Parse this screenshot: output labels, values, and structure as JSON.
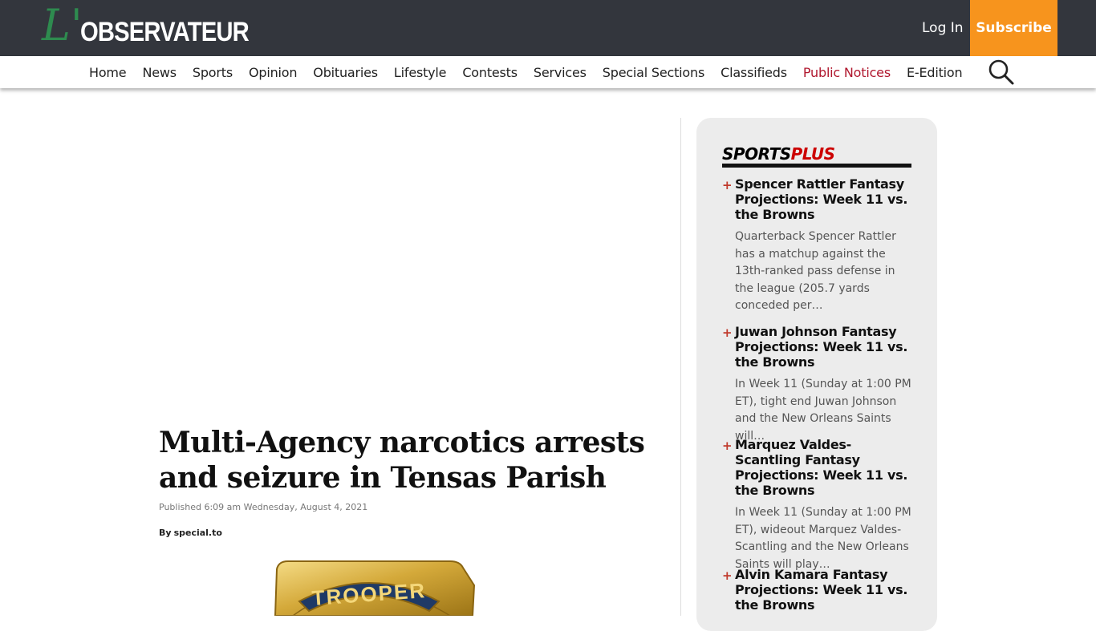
{
  "header": {
    "logo_script": "L'",
    "logo_text": "OBSERVATEUR",
    "login_label": "Log In",
    "subscribe_label": "Subscribe",
    "colors": {
      "topbar": "#33363d",
      "subscribe": "#f7941d",
      "logo_script": "#2e8b4f",
      "accent_red": "#b0172e"
    }
  },
  "nav": {
    "items": [
      {
        "label": "Home"
      },
      {
        "label": "News"
      },
      {
        "label": "Sports"
      },
      {
        "label": "Opinion"
      },
      {
        "label": "Obituaries"
      },
      {
        "label": "Lifestyle"
      },
      {
        "label": "Contests"
      },
      {
        "label": "Services"
      },
      {
        "label": "Special Sections"
      },
      {
        "label": "Classifieds"
      },
      {
        "label": "Public Notices"
      },
      {
        "label": "E-Edition"
      }
    ],
    "search_icon": "search-icon"
  },
  "article": {
    "headline": "Multi-Agency narcotics arrests and seizure in Tensas Parish",
    "published": "Published 6:09 am Wednesday, August 4, 2021",
    "byline_prefix": "By",
    "byline_author": "special.to",
    "image_text": "TROOPER"
  },
  "sidebar": {
    "title_part1": "SPORTS",
    "title_part2": "PLUS",
    "bullet": "+",
    "items": [
      {
        "title": "Spencer Rattler Fantasy Projections: Week 11 vs. the Browns",
        "excerpt": "Quarterback Spencer Rattler has a matchup against the 13th-ranked pass defense in the league (205.7 yards conceded per…"
      },
      {
        "title": "Juwan Johnson Fantasy Projections: Week 11 vs. the Browns",
        "excerpt": "In Week 11 (Sunday at 1:00 PM ET), tight end Juwan Johnson and the New Orleans Saints will…"
      },
      {
        "title": "Marquez Valdes-Scantling Fantasy Projections: Week 11 vs. the Browns",
        "excerpt": "In Week 11 (Sunday at 1:00 PM ET), wideout Marquez Valdes-Scantling and the New Orleans Saints will play…"
      },
      {
        "title": "Alvin Kamara Fantasy Projections: Week 11 vs. the Browns",
        "excerpt": ""
      }
    ]
  }
}
